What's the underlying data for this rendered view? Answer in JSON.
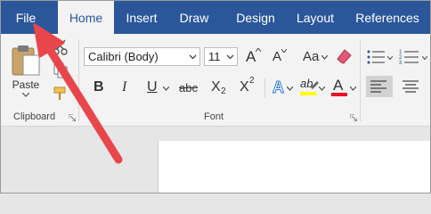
{
  "tabs": [
    {
      "label": "File"
    },
    {
      "label": "Home"
    },
    {
      "label": "Insert"
    },
    {
      "label": "Draw"
    },
    {
      "label": "Design"
    },
    {
      "label": "Layout"
    },
    {
      "label": "References"
    }
  ],
  "clipboard": {
    "paste_label": "Paste",
    "group_label": "Clipboard"
  },
  "font": {
    "family_value": "Calibri (Body)",
    "size_value": "11",
    "group_label": "Font",
    "bold": "B",
    "italic": "I",
    "underline": "U",
    "strikethrough": "abc",
    "subscript": "X",
    "subscript_sub": "2",
    "superscript": "X",
    "superscript_sup": "2",
    "change_case": "Aa",
    "grow_a": "A",
    "shrink_a": "A",
    "text_effects": "A",
    "highlight": "ab",
    "font_color": "A"
  },
  "colors": {
    "tab_bar": "#2b579a",
    "ribbon": "#f3f3f3",
    "annotation_arrow": "#e8464b",
    "highlight_yellow": "#ffff00",
    "font_color_red": "#e81123"
  }
}
